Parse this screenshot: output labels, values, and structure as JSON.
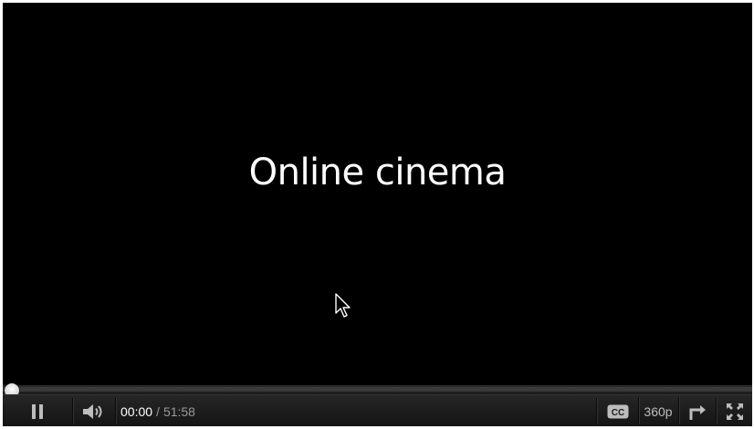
{
  "video": {
    "title": "Online cinema"
  },
  "progress": {
    "played_fraction": 0.0
  },
  "controls": {
    "current_time": "00:00",
    "separator": "/",
    "duration": "51:58",
    "quality": "360p",
    "icons": [
      "pause-icon",
      "volume-icon",
      "captions-icon",
      "popout-icon",
      "fullscreen-icon"
    ]
  },
  "colors": {
    "background": "#000000",
    "controls_bar": "#1c1c1c",
    "title_text": "#ffffff"
  }
}
